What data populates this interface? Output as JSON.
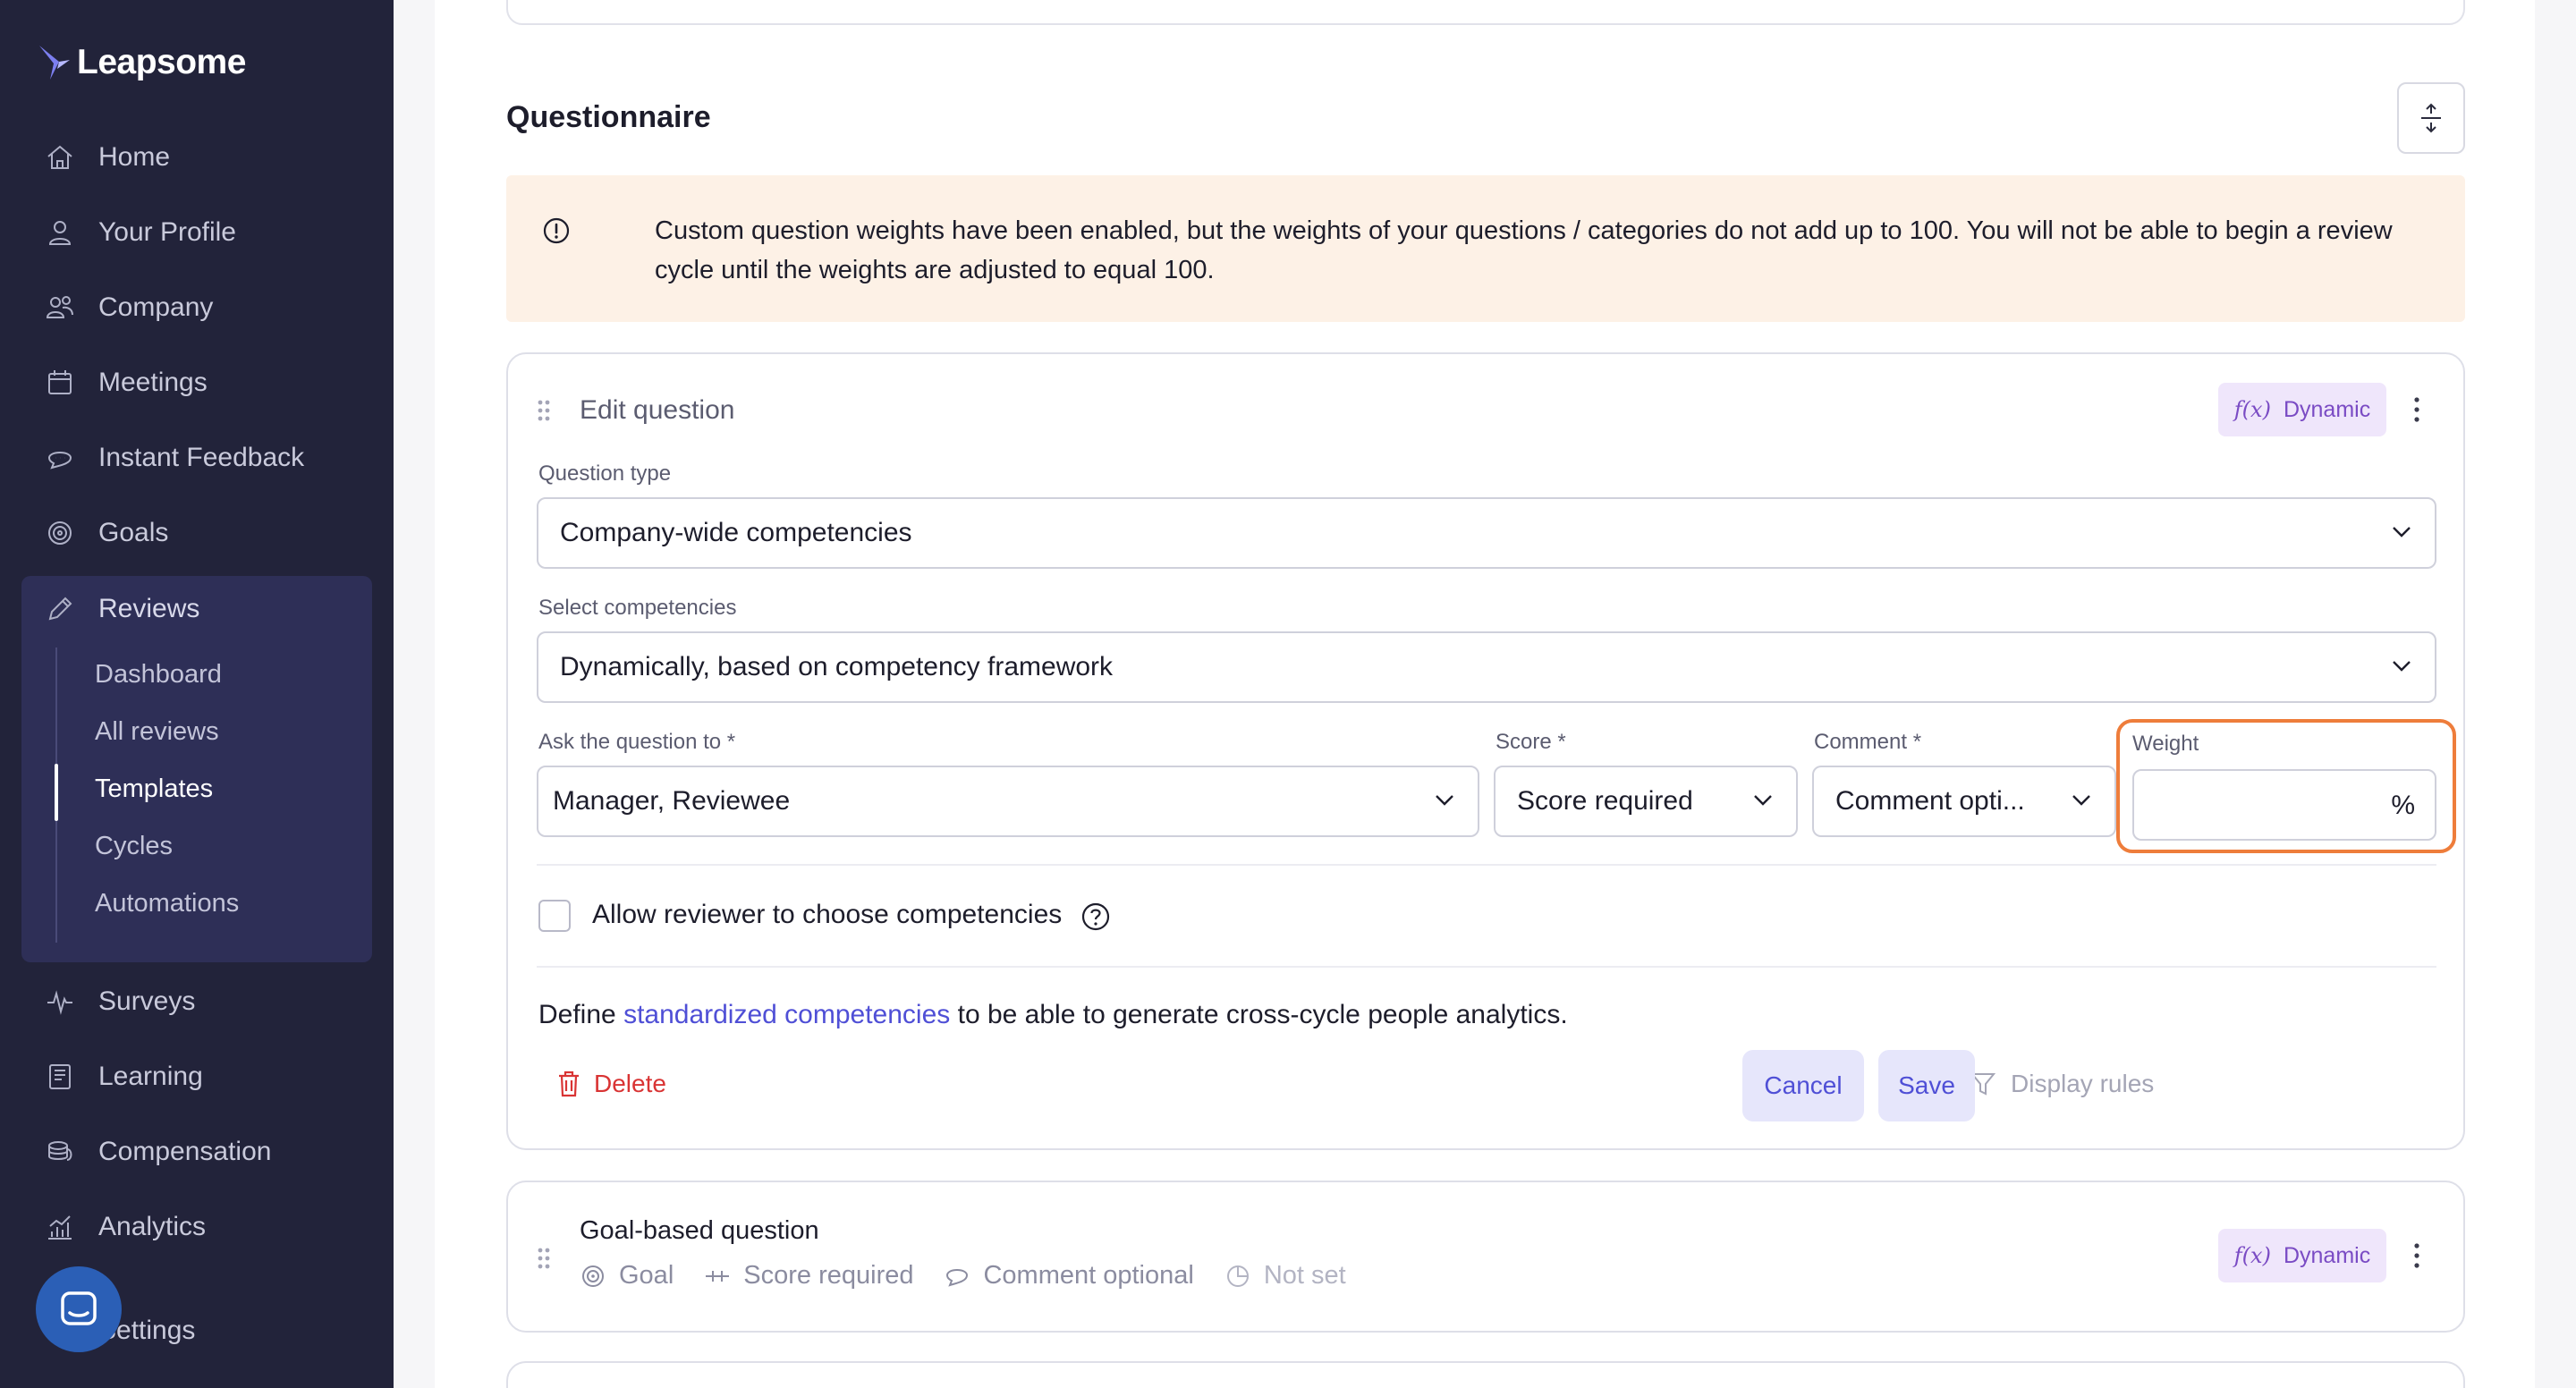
{
  "app": {
    "name": "Leapsome"
  },
  "sidebar": {
    "items": [
      {
        "label": "Home",
        "icon": "home-icon"
      },
      {
        "label": "Your Profile",
        "icon": "user-icon"
      },
      {
        "label": "Company",
        "icon": "people-icon"
      },
      {
        "label": "Meetings",
        "icon": "calendar-icon"
      },
      {
        "label": "Instant Feedback",
        "icon": "chat-icon"
      },
      {
        "label": "Goals",
        "icon": "target-icon"
      }
    ],
    "reviews": {
      "label": "Reviews",
      "icon": "pencil-icon",
      "sub_items": [
        {
          "label": "Dashboard"
        },
        {
          "label": "All reviews"
        },
        {
          "label": "Templates",
          "active": true
        },
        {
          "label": "Cycles"
        },
        {
          "label": "Automations"
        }
      ]
    },
    "lower_items": [
      {
        "label": "Surveys",
        "icon": "pulse-icon"
      },
      {
        "label": "Learning",
        "icon": "book-icon"
      },
      {
        "label": "Compensation",
        "icon": "coins-icon"
      },
      {
        "label": "Analytics",
        "icon": "chart-icon"
      },
      {
        "label": "Settings",
        "icon": "settings-icon"
      }
    ]
  },
  "main": {
    "section_title": "Questionnaire",
    "warning_text": "Custom question weights have been enabled, but the weights of your questions / categories do not add up to 100. You will not be able to begin a review cycle until the weights are adjusted to equal 100.",
    "edit_question": {
      "title": "Edit question",
      "badge": "Dynamic",
      "badge_fx": "f(x)",
      "question_type_label": "Question type",
      "question_type_value": "Company-wide competencies",
      "competencies_label": "Select competencies",
      "competencies_value": "Dynamically, based on competency framework",
      "ask_label": "Ask the question to *",
      "ask_value": "Manager, Reviewee",
      "score_label": "Score *",
      "score_value": "Score required",
      "comment_label": "Comment *",
      "comment_value": "Comment opti...",
      "weight_label": "Weight",
      "weight_value": "",
      "weight_unit": "%",
      "allow_reviewer_label": "Allow reviewer to choose competencies",
      "define_prefix": "Define ",
      "define_link": "standardized competencies",
      "define_suffix": " to be able to generate cross-cycle people analytics.",
      "delete_label": "Delete",
      "display_rules_label": "Display rules",
      "cancel_label": "Cancel",
      "save_label": "Save"
    },
    "goal_question": {
      "title": "Goal-based question",
      "badge": "Dynamic",
      "badge_fx": "f(x)",
      "meta": [
        {
          "label": "Goal",
          "icon": "target-icon"
        },
        {
          "label": "Score required",
          "icon": "score-icon"
        },
        {
          "label": "Comment optional",
          "icon": "comment-icon"
        },
        {
          "label": "Not set",
          "icon": "pie-icon"
        }
      ]
    }
  },
  "colors": {
    "sidebar_bg": "#22233a",
    "reviews_block_bg": "#2e2f57",
    "accent": "#4f4fd6",
    "warning_bg": "#fdf1e6",
    "weight_highlight": "#ee7d3b",
    "delete": "#d93434",
    "dynamic_badge_bg": "#efe6fb",
    "dynamic_badge_text": "#7a4bc4"
  }
}
